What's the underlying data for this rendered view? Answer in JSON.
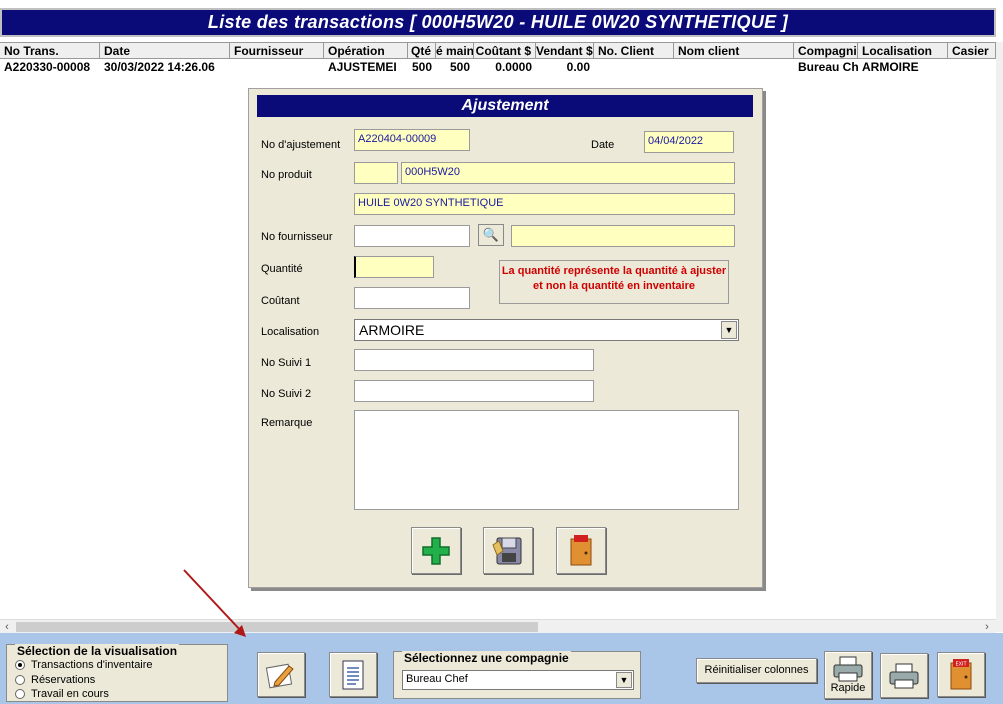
{
  "window": {
    "title": "Liste des transactions  [ 000H5W20 - HUILE 0W20 SYNTHETIQUE ]"
  },
  "grid": {
    "columns": [
      "No Trans.",
      "Date",
      "Fournisseur",
      "Opération",
      "Qté",
      "é main",
      "Coûtant $",
      "Vendant $",
      "No. Client",
      "Nom client",
      "Compagnie",
      "Localisation",
      "Casier"
    ],
    "rows": [
      [
        "A220330-00008",
        "30/03/2022 14:26.06",
        "",
        "AJUSTEMEI",
        "500",
        "500",
        "0.0000",
        "0.00",
        "",
        "",
        "Bureau Ch",
        "ARMOIRE",
        ""
      ]
    ]
  },
  "dialog": {
    "title": "Ajustement",
    "labels": {
      "no_ajustement": "No d'ajustement",
      "date": "Date",
      "no_produit": "No produit",
      "no_fournisseur": "No fournisseur",
      "quantite": "Quantité",
      "coutant": "Coûtant",
      "localisation": "Localisation",
      "no_suivi_1": "No Suivi 1",
      "no_suivi_2": "No Suivi 2",
      "remarque": "Remarque"
    },
    "values": {
      "no_ajustement": "A220404-00009",
      "date": "04/04/2022",
      "no_produit_prefix": "",
      "no_produit": "000H5W20",
      "description": "HUILE 0W20 SYNTHETIQUE",
      "no_fournisseur": "",
      "fournisseur_nom": "",
      "quantite": "",
      "coutant": "",
      "localisation": "ARMOIRE",
      "no_suivi_1": "",
      "no_suivi_2": "",
      "remarque": ""
    },
    "note": "La quantité représente la quantité à ajuster et non la quantité en inventaire",
    "icons": [
      "add-icon",
      "save-icon",
      "exit-icon"
    ]
  },
  "bottom": {
    "view_group_title": "Sélection de la visualisation",
    "view_options": [
      "Transactions d'inventaire",
      "Réservations",
      "Travail en cours"
    ],
    "view_selected": 0,
    "company_group_title": "Sélectionnez une compagnie",
    "company_selected": "Bureau Chef",
    "reset_columns_label": "Réinitialiser colonnes",
    "print_quick_label": "Rapide",
    "exit_badge": "EXIT"
  },
  "colors": {
    "title_bg": "#0a0a78",
    "dialog_bg": "#ece9d8",
    "field_yellow": "#ffffc0",
    "bottom_bg": "#a9c6e8",
    "note_red": "#d00000"
  }
}
